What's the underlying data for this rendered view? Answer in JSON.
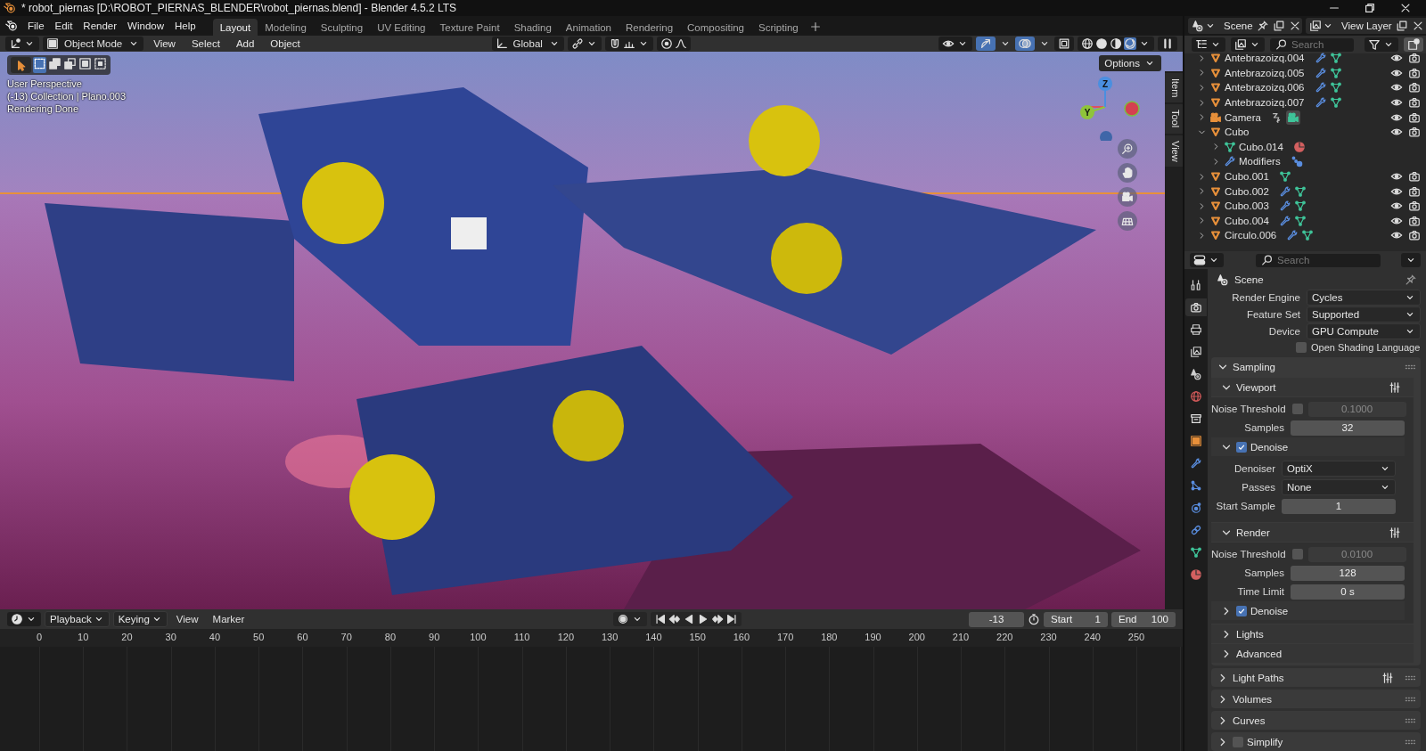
{
  "window": {
    "title": "* robot_piernas [D:\\ROBOT_PIERNAS_BLENDER\\robot_piernas.blend] - Blender 4.5.2 LTS"
  },
  "menu": [
    "File",
    "Edit",
    "Render",
    "Window",
    "Help"
  ],
  "workspaces": [
    {
      "label": "Layout",
      "selected": true
    },
    {
      "label": "Modeling",
      "selected": false
    },
    {
      "label": "Sculpting",
      "selected": false
    },
    {
      "label": "UV Editing",
      "selected": false
    },
    {
      "label": "Texture Paint",
      "selected": false
    },
    {
      "label": "Shading",
      "selected": false
    },
    {
      "label": "Animation",
      "selected": false
    },
    {
      "label": "Rendering",
      "selected": false
    },
    {
      "label": "Compositing",
      "selected": false
    },
    {
      "label": "Scripting",
      "selected": false
    }
  ],
  "scene": {
    "value": "Scene"
  },
  "view_layer": {
    "value": "View Layer"
  },
  "viewport": {
    "mode": "Object Mode",
    "menus": [
      "View",
      "Select",
      "Add",
      "Object"
    ],
    "orientation": "Global",
    "info": [
      "User Perspective",
      "(-13) Collection | Plano.003",
      "Rendering Done"
    ],
    "options": "Options",
    "axes": [
      "Z",
      "Y"
    ],
    "sidebar_tabs": [
      "Item",
      "Tool",
      "View"
    ]
  },
  "outliner": {
    "search": {
      "placeholder": "Search"
    },
    "items": [
      {
        "kind": "mesh_object",
        "name": "Antebrazoizq.004",
        "modifiers": true,
        "expanded": false
      },
      {
        "kind": "mesh_object",
        "name": "Antebrazoizq.005",
        "modifiers": true,
        "expanded": false
      },
      {
        "kind": "mesh_object",
        "name": "Antebrazoizq.006",
        "modifiers": true,
        "expanded": false
      },
      {
        "kind": "mesh_object",
        "name": "Antebrazoizq.007",
        "modifiers": true,
        "expanded": false
      },
      {
        "kind": "camera",
        "name": "Camera",
        "expanded": false
      },
      {
        "kind": "mesh_object",
        "name": "Cubo",
        "modifiers": false,
        "expanded": true,
        "children": [
          {
            "kind": "mesh_data",
            "name": "Cubo.014",
            "expanded": false
          },
          {
            "kind": "modifiers",
            "name": "Modifiers",
            "expanded": false
          }
        ]
      },
      {
        "kind": "mesh_object",
        "name": "Cubo.001",
        "modifiers": false,
        "expanded": false
      },
      {
        "kind": "mesh_object",
        "name": "Cubo.002",
        "modifiers": true,
        "expanded": false
      },
      {
        "kind": "mesh_object",
        "name": "Cubo.003",
        "modifiers": true,
        "expanded": false
      },
      {
        "kind": "mesh_object",
        "name": "Cubo.004",
        "modifiers": true,
        "expanded": false
      },
      {
        "kind": "mesh_object",
        "name": "Circulo.006",
        "modifiers": true,
        "expanded": false
      }
    ]
  },
  "properties": {
    "search": {
      "placeholder": "Search"
    },
    "tabs": [
      {
        "kind": "tool",
        "selected": false
      },
      {
        "kind": "render",
        "selected": true
      },
      {
        "kind": "output",
        "selected": false
      },
      {
        "kind": "view_layer",
        "selected": false
      },
      {
        "kind": "scene",
        "selected": false
      },
      {
        "kind": "world",
        "selected": false
      },
      {
        "kind": "collection",
        "selected": false
      },
      {
        "kind": "object",
        "selected": false
      },
      {
        "kind": "modifiers",
        "selected": false
      },
      {
        "kind": "particles",
        "selected": false
      },
      {
        "kind": "physics",
        "selected": false
      },
      {
        "kind": "constraints",
        "selected": false
      },
      {
        "kind": "data",
        "selected": false
      },
      {
        "kind": "material",
        "selected": false
      }
    ],
    "context": "Scene",
    "fields": [
      {
        "kind": "dropdown",
        "label": "Render Engine",
        "value": "Cycles"
      },
      {
        "kind": "dropdown",
        "label": "Feature Set",
        "value": "Supported"
      },
      {
        "kind": "dropdown",
        "label": "Device",
        "value": "GPU Compute"
      },
      {
        "kind": "checkbox",
        "label": "Open Shading Language",
        "checked": false
      }
    ],
    "panels": [
      {
        "title": "Sampling",
        "expanded": true,
        "children": [
          {
            "kind": "subpanel",
            "title": "Viewport",
            "expanded": true,
            "presets": true,
            "children": [
              {
                "kind": "threshold",
                "label": "Noise Threshold",
                "checked": false,
                "value": "0.1000"
              },
              {
                "kind": "number",
                "label": "Samples",
                "value": "32"
              },
              {
                "kind": "subpanel",
                "title": "Denoise",
                "expanded": true,
                "checked": true,
                "children": [
                  {
                    "kind": "dropdown",
                    "label": "Denoiser",
                    "value": "OptiX"
                  },
                  {
                    "kind": "dropdown",
                    "label": "Passes",
                    "value": "None"
                  },
                  {
                    "kind": "number",
                    "label": "Start Sample",
                    "value": "1"
                  }
                ]
              }
            ]
          },
          {
            "kind": "subpanel",
            "title": "Render",
            "expanded": true,
            "presets": true,
            "children": [
              {
                "kind": "threshold",
                "label": "Noise Threshold",
                "checked": false,
                "value": "0.0100"
              },
              {
                "kind": "number",
                "label": "Samples",
                "value": "128"
              },
              {
                "kind": "number",
                "label": "Time Limit",
                "value": "0 s"
              },
              {
                "kind": "subpanel",
                "title": "Denoise",
                "expanded": false,
                "checked": true
              }
            ]
          },
          {
            "kind": "subpanel",
            "title": "Lights",
            "expanded": false
          },
          {
            "kind": "subpanel",
            "title": "Advanced",
            "expanded": false
          }
        ]
      },
      {
        "title": "Light Paths",
        "expanded": false,
        "presets": true
      },
      {
        "title": "Volumes",
        "expanded": false
      },
      {
        "title": "Curves",
        "expanded": false
      },
      {
        "title": "Simplify",
        "expanded": false,
        "checked": false
      }
    ]
  },
  "timeline": {
    "menus": [
      {
        "label": "Playback",
        "dropdown": true
      },
      {
        "label": "Keying",
        "dropdown": true
      },
      {
        "label": "View",
        "dropdown": false
      },
      {
        "label": "Marker",
        "dropdown": false
      }
    ],
    "current_frame": "-13",
    "start": {
      "label": "Start",
      "value": "1"
    },
    "end": {
      "label": "End",
      "value": "100"
    },
    "ruler": [
      "0",
      "10",
      "20",
      "30",
      "40",
      "50",
      "60",
      "70",
      "80",
      "90",
      "100",
      "110",
      "120",
      "130",
      "140",
      "150",
      "160",
      "170",
      "180",
      "190",
      "200",
      "210",
      "220",
      "230",
      "240",
      "250"
    ]
  }
}
